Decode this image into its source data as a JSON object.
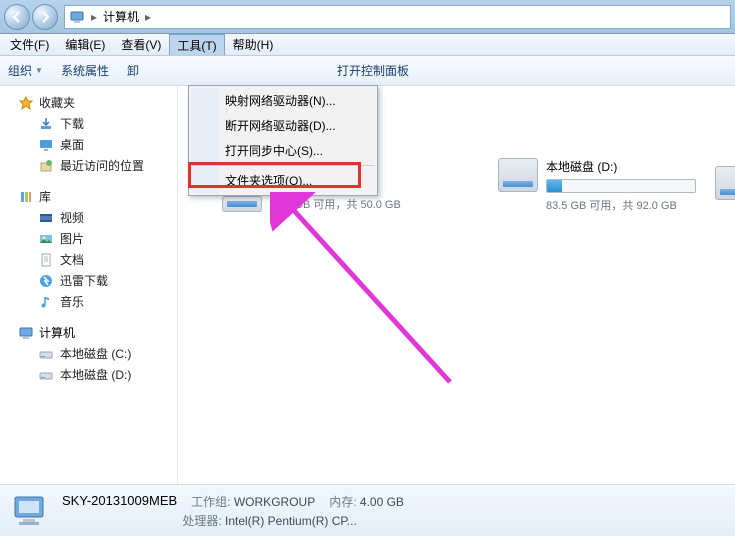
{
  "address": {
    "root_icon": "computer-icon",
    "root_label": "计算机"
  },
  "menubar": {
    "file": "文件(F)",
    "edit": "编辑(E)",
    "view": "查看(V)",
    "tools": "工具(T)",
    "help": "帮助(H)"
  },
  "cmdbar": {
    "organize": "组织",
    "sysprops": "系统属性",
    "uninstall": "卸",
    "controlpanel": "打开控制面板"
  },
  "tools_menu": {
    "map_drive": "映射网络驱动器(N)...",
    "disconnect_drive": "断开网络驱动器(D)...",
    "sync_center": "打开同步中心(S)...",
    "folder_options": "文件夹选项(O)..."
  },
  "sidebar": {
    "favorites": {
      "label": "收藏夹"
    },
    "downloads": "下载",
    "desktop": "桌面",
    "recent": "最近访问的位置",
    "libraries": {
      "label": "库"
    },
    "videos": "视频",
    "pictures": "图片",
    "documents": "文档",
    "xunlei": "迅雷下载",
    "music": "音乐",
    "computer": {
      "label": "计算机"
    },
    "drive_c": "本地磁盘 (C:)",
    "drive_d": "本地磁盘 (D:)"
  },
  "drives": {
    "d": {
      "name": "本地磁盘 (D:)",
      "free_text": "83.5 GB 可用，共 92.0 GB",
      "fill_pct": 10
    },
    "c_hidden": {
      "free_text": "38.9 GB 可用，共 50.0 GB"
    }
  },
  "status": {
    "computer_name": "SKY-20131009MEB",
    "workgroup_label": "工作组:",
    "workgroup": "WORKGROUP",
    "mem_label": "内存:",
    "mem": "4.00 GB",
    "cpu_label": "处理器:",
    "cpu": "Intel(R) Pentium(R) CP..."
  }
}
